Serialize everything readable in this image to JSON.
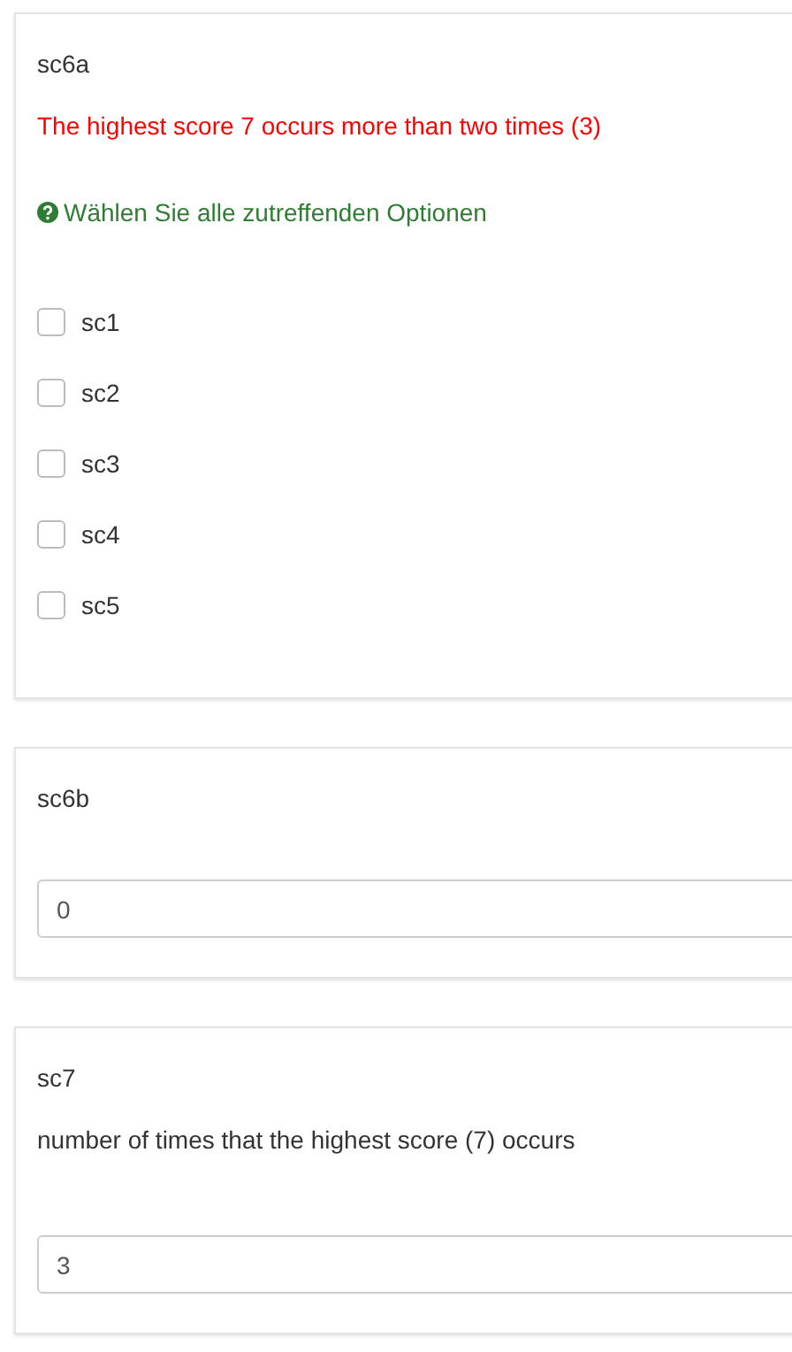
{
  "questions": [
    {
      "kind": "checkbox",
      "title": "sc6a",
      "error": "The highest score 7 occurs more than two times (3)",
      "hint": "Wählen Sie alle zutreffenden Optionen",
      "options": [
        {
          "label": "sc1",
          "checked": false
        },
        {
          "label": "sc2",
          "checked": false
        },
        {
          "label": "sc3",
          "checked": false
        },
        {
          "label": "sc4",
          "checked": false
        },
        {
          "label": "sc5",
          "checked": false
        }
      ]
    },
    {
      "kind": "number",
      "title": "sc6b",
      "value": "0"
    },
    {
      "kind": "number",
      "title": "sc7",
      "description": "number of times that the highest score (7) occurs",
      "value": "3"
    }
  ]
}
